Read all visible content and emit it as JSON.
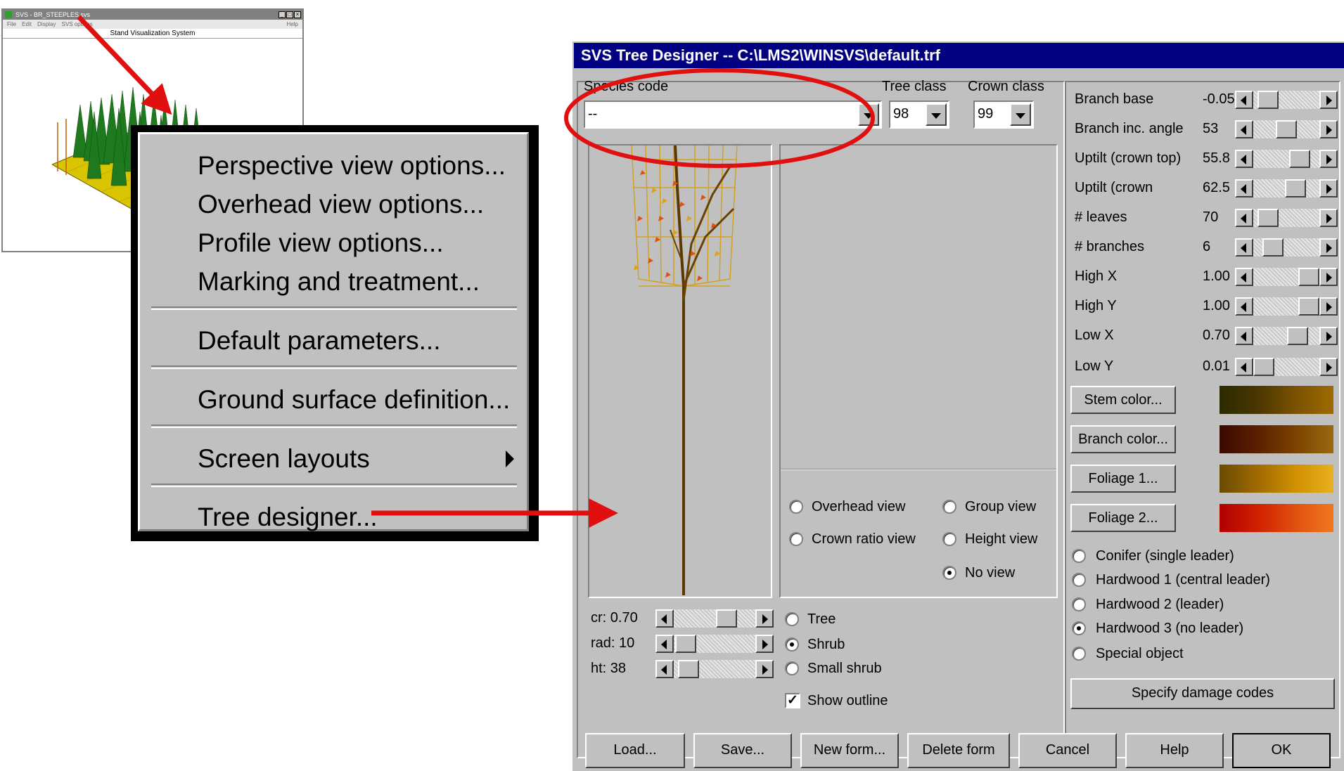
{
  "svs_window": {
    "title": "SVS - BR_STEEPLES.svs",
    "menus": [
      "File",
      "Edit",
      "Display",
      "SVS options"
    ],
    "help_menu": "Help",
    "header": "Stand Visualization System"
  },
  "context_menu": {
    "items": [
      {
        "label": "Perspective view options...",
        "mnemonic": "P"
      },
      {
        "label": "Overhead view options...",
        "mnemonic": "O"
      },
      {
        "label": "Profile view options...",
        "mnemonic": "f"
      },
      {
        "label": "Marking and treatment...",
        "mnemonic": "M"
      },
      {
        "label": "Default parameters...",
        "mnemonic": "D"
      },
      {
        "label": "Ground surface definition...",
        "mnemonic": "G"
      },
      {
        "label": "Screen layouts",
        "mnemonic": "S"
      },
      {
        "label": "Tree designer...",
        "mnemonic": "T"
      }
    ]
  },
  "designer": {
    "title": "SVS Tree Designer -- C:\\LMS2\\WINSVS\\default.trf",
    "species_code": {
      "label": "Species code",
      "value": "--"
    },
    "tree_class": {
      "label": "Tree class",
      "value": "98"
    },
    "crown_class": {
      "label": "Crown class",
      "value": "99"
    },
    "view_options": [
      {
        "label": "Overhead view",
        "selected": false
      },
      {
        "label": "Group view",
        "selected": false
      },
      {
        "label": "Crown ratio view",
        "selected": false
      },
      {
        "label": "Height view",
        "selected": false
      },
      {
        "label": "No view",
        "selected": true
      }
    ],
    "size_controls": [
      {
        "label": "cr: 0.70",
        "level": 0.75
      },
      {
        "label": "rad: 10",
        "level": 0.05
      },
      {
        "label": "ht: 38",
        "level": 0.1
      }
    ],
    "form_type": [
      {
        "label": "Tree",
        "selected": false
      },
      {
        "label": "Shrub",
        "selected": true
      },
      {
        "label": "Small shrub",
        "selected": false
      }
    ],
    "show_outline": {
      "label": "Show outline",
      "checked": true
    },
    "parameters": [
      {
        "label": "Branch base",
        "value": "-0.05",
        "level": 0.1
      },
      {
        "label": "Branch inc. angle",
        "value": "53",
        "level": 0.5
      },
      {
        "label": "Uptilt (crown top)",
        "value": "55.8",
        "level": 0.8
      },
      {
        "label": "Uptilt (crown",
        "value": "62.5",
        "level": 0.7
      },
      {
        "label": "# leaves",
        "value": "70",
        "level": 0.1
      },
      {
        "label": "# branches",
        "value": "6",
        "level": 0.2
      },
      {
        "label": "High X",
        "value": "1.00",
        "level": 1.0
      },
      {
        "label": "High Y",
        "value": "1.00",
        "level": 1.0
      },
      {
        "label": "Low X",
        "value": "0.70",
        "level": 0.75
      },
      {
        "label": "Low Y",
        "value": "0.01",
        "level": 0.0
      }
    ],
    "color_buttons": [
      {
        "label": "Stem color...",
        "colors": [
          "#2a2a00",
          "#4a3600",
          "#7a5200",
          "#a06a00"
        ]
      },
      {
        "label": "Branch color...",
        "colors": [
          "#3a0a00",
          "#5a2000",
          "#7a4200",
          "#9a6a10"
        ]
      },
      {
        "label": "Foliage 1...",
        "colors": [
          "#6a4a00",
          "#a06a00",
          "#d09000",
          "#e8b020"
        ]
      },
      {
        "label": "Foliage 2...",
        "colors": [
          "#b00000",
          "#d02000",
          "#e05010",
          "#f07820"
        ]
      }
    ],
    "crown_types": [
      {
        "label": "Conifer (single leader)",
        "selected": false
      },
      {
        "label": "Hardwood 1 (central leader)",
        "selected": false
      },
      {
        "label": "Hardwood 2 (leader)",
        "selected": false
      },
      {
        "label": "Hardwood 3 (no leader)",
        "selected": true
      },
      {
        "label": "Special object",
        "selected": false
      }
    ],
    "damage_button": "Specify damage codes",
    "bottom_buttons": [
      "Load...",
      "Save...",
      "New form...",
      "Delete form",
      "Cancel",
      "Help",
      "OK"
    ]
  },
  "colors": {
    "accent_red": "#e01010",
    "title_blue": "#000080",
    "face": "#c0c0c0"
  }
}
